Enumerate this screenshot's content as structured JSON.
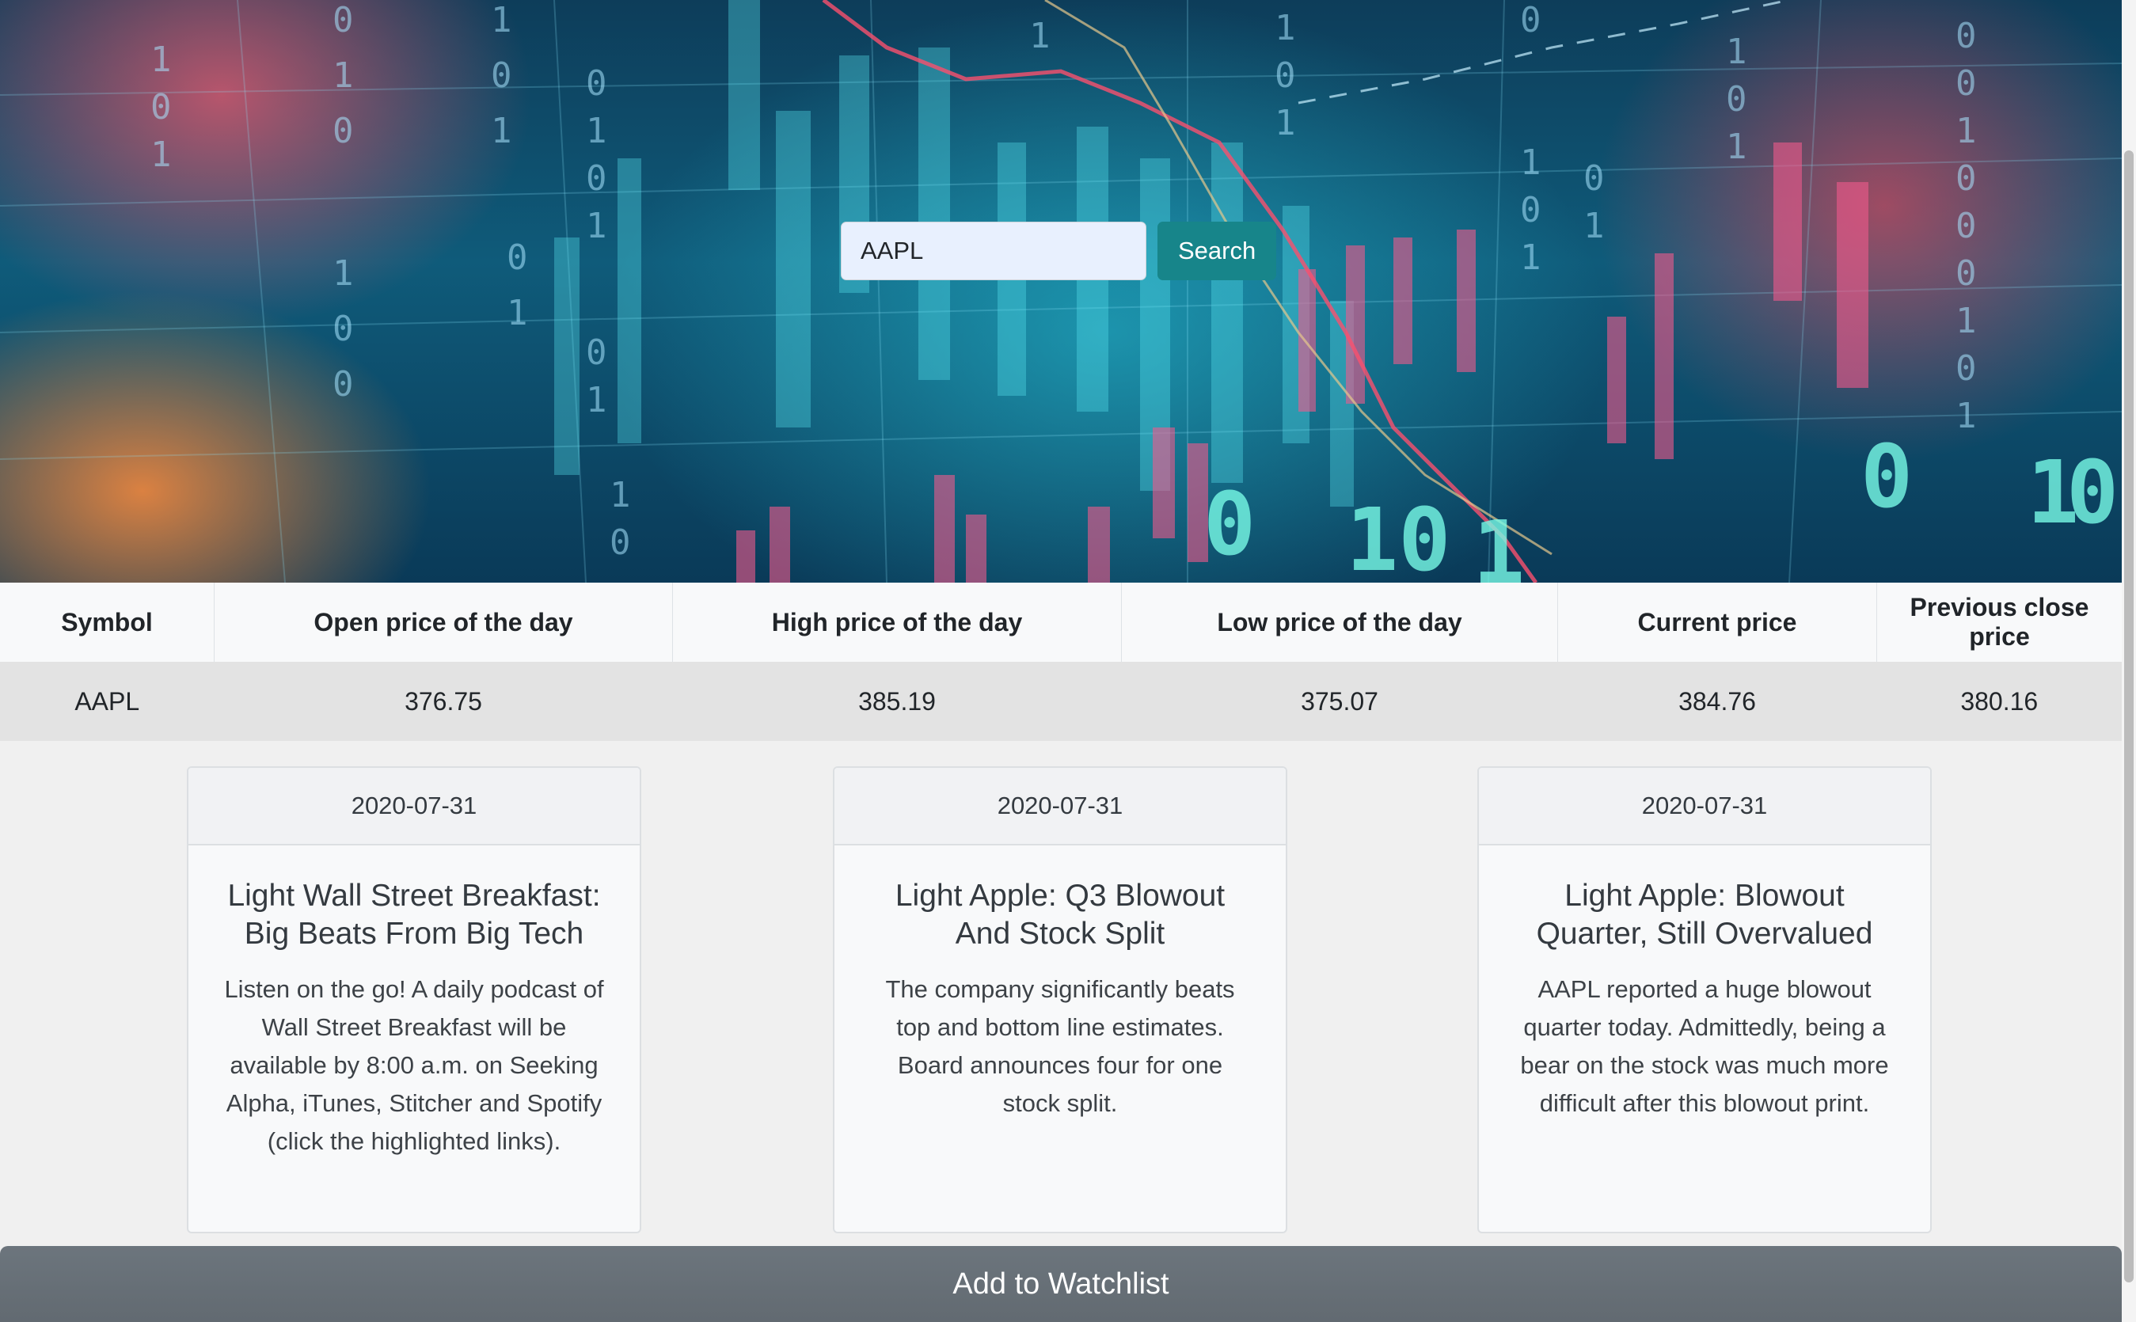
{
  "search": {
    "value": "AAPL",
    "button_label": "Search"
  },
  "quote_table": {
    "headers": [
      "Symbol",
      "Open price of the day",
      "High price of the day",
      "Low price of the day",
      "Current price",
      "Previous close price"
    ],
    "row": [
      "AAPL",
      "376.75",
      "385.19",
      "375.07",
      "384.76",
      "380.16"
    ]
  },
  "news_cards": [
    {
      "date": "2020-07-31",
      "title": "Light Wall Street Breakfast: Big Beats From Big Tech",
      "text": "Listen on the go! A daily podcast of Wall Street Breakfast will be available by 8:00 a.m. on Seeking Alpha, iTunes, Stitcher and Spotify (click the highlighted links)."
    },
    {
      "date": "2020-07-31",
      "title": "Light Apple: Q3 Blowout And Stock Split",
      "text": "The company significantly beats top and bottom line estimates. Board announces four for one stock split."
    },
    {
      "date": "2020-07-31",
      "title": "Light Apple: Blowout Quarter, Still Overvalued",
      "text": "AAPL reported a huge blowout quarter today. Admittedly, being a bear on the stock was much more difficult after this blowout print."
    }
  ],
  "watchlist": {
    "button_label": "Add to Watchlist"
  },
  "colors": {
    "search_button": "#17858a",
    "watchlist_button": "#6c757d",
    "input_bg": "#e8f0fe"
  },
  "hero": {
    "background_icon": "stock-chart-background-icon"
  }
}
